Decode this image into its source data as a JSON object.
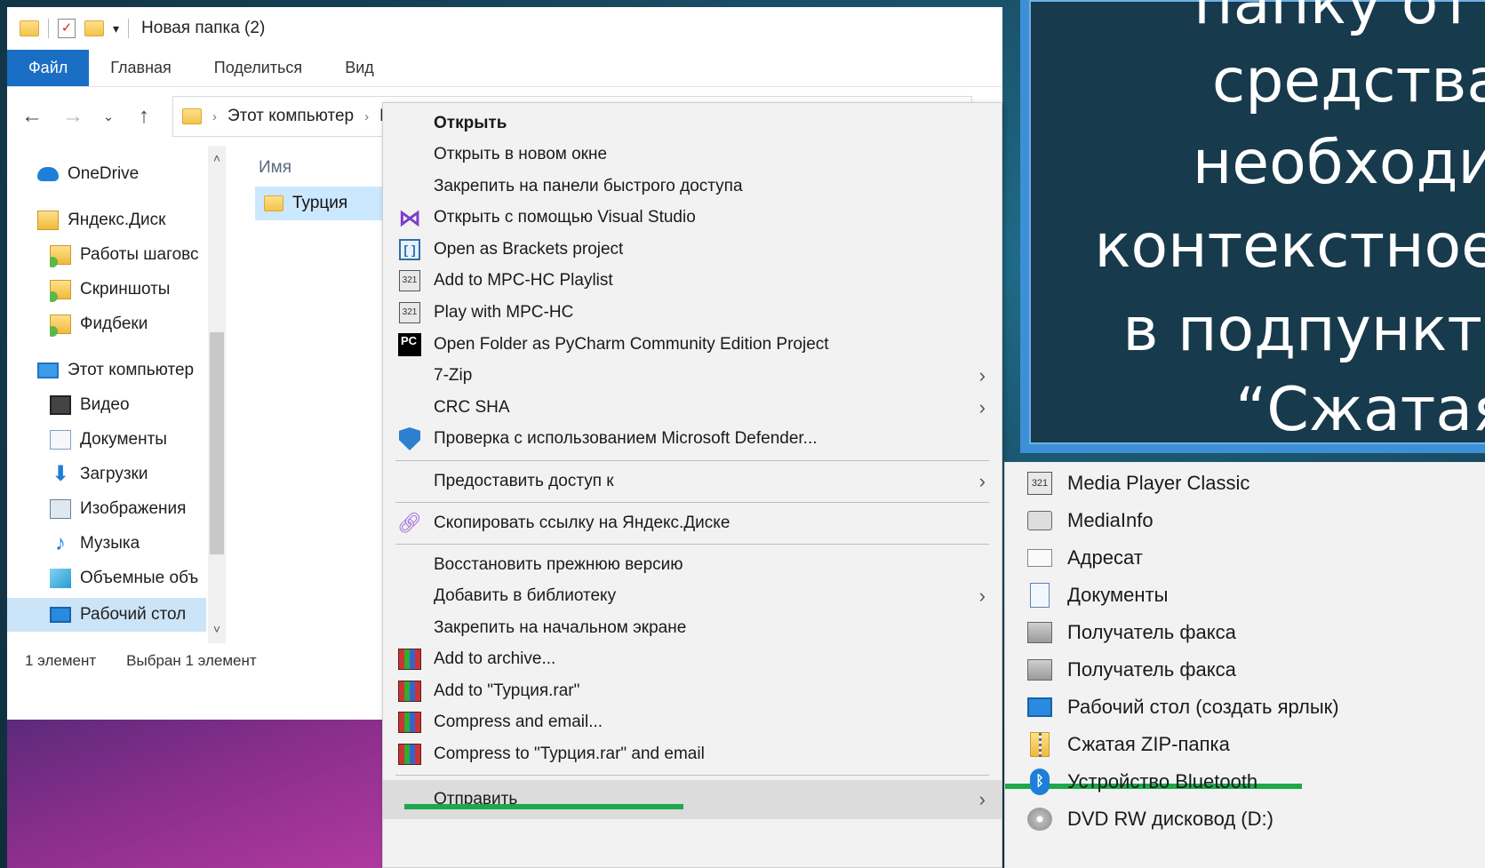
{
  "window": {
    "title": "Новая папка (2)"
  },
  "ribbon": {
    "tabs": [
      "Файл",
      "Главная",
      "Поделиться",
      "Вид"
    ]
  },
  "address": {
    "crumbs": [
      "Этот компьютер",
      "Р"
    ]
  },
  "nav": {
    "items": [
      {
        "label": "OneDrive",
        "icon": "cloud-icon"
      },
      {
        "label": "Яндекс.Диск",
        "icon": "yandex-disk-icon"
      },
      {
        "label": "Работы шаговс",
        "icon": "folder-synced-icon"
      },
      {
        "label": "Скриншоты",
        "icon": "folder-synced-icon"
      },
      {
        "label": "Фидбеки",
        "icon": "folder-synced-icon"
      },
      {
        "label": "Этот компьютер",
        "icon": "computer-icon"
      },
      {
        "label": "Видео",
        "icon": "video-icon"
      },
      {
        "label": "Документы",
        "icon": "documents-icon"
      },
      {
        "label": "Загрузки",
        "icon": "downloads-icon"
      },
      {
        "label": "Изображения",
        "icon": "pictures-icon"
      },
      {
        "label": "Музыка",
        "icon": "music-icon"
      },
      {
        "label": "Объемные объ",
        "icon": "3d-objects-icon"
      },
      {
        "label": "Рабочий стол",
        "icon": "desktop-icon"
      }
    ]
  },
  "files": {
    "column_name": "Имя",
    "items": [
      {
        "label": "Турция",
        "icon": "folder-icon"
      }
    ]
  },
  "status": {
    "count": "1 элемент",
    "selected": "Выбран 1 элемент"
  },
  "context_menu": {
    "items": [
      {
        "label": "Открыть"
      },
      {
        "label": "Открыть в новом окне"
      },
      {
        "label": "Закрепить на панели быстрого доступа"
      },
      {
        "label": "Открыть с помощью Visual Studio",
        "icon": "visual-studio-icon"
      },
      {
        "label": "Open as Brackets project",
        "icon": "brackets-icon"
      },
      {
        "label": "Add to MPC-HC Playlist",
        "icon": "mpc-hc-icon"
      },
      {
        "label": "Play with MPC-HC",
        "icon": "mpc-hc-icon"
      },
      {
        "label": "Open Folder as PyCharm Community Edition Project",
        "icon": "pycharm-icon"
      },
      {
        "label": "7-Zip"
      },
      {
        "label": "CRC SHA"
      },
      {
        "label": "Проверка с использованием Microsoft Defender...",
        "icon": "defender-icon"
      },
      {
        "label": "Предоставить доступ к"
      },
      {
        "label": "Скопировать ссылку на Яндекс.Диске",
        "icon": "link-icon"
      },
      {
        "label": "Восстановить прежнюю версию"
      },
      {
        "label": "Добавить в библиотеку"
      },
      {
        "label": "Закрепить на начальном экране"
      },
      {
        "label": "Add to archive...",
        "icon": "winrar-icon"
      },
      {
        "label": "Add to \"Турция.rar\"",
        "icon": "winrar-icon"
      },
      {
        "label": "Compress and email...",
        "icon": "winrar-icon"
      },
      {
        "label": "Compress to \"Турция.rar\" and email",
        "icon": "winrar-icon"
      },
      {
        "label": "Отправить"
      }
    ]
  },
  "send_to": {
    "items": [
      {
        "label": "Media Player Classic",
        "icon": "mpc-icon"
      },
      {
        "label": "MediaInfo",
        "icon": "mediainfo-icon"
      },
      {
        "label": "Адресат",
        "icon": "mail-recipient-icon"
      },
      {
        "label": "Документы",
        "icon": "documents-icon"
      },
      {
        "label": "Получатель факса",
        "icon": "fax-icon"
      },
      {
        "label": "Получатель факса",
        "icon": "fax-icon"
      },
      {
        "label": "Рабочий стол (создать ярлык)",
        "icon": "desktop-icon"
      },
      {
        "label": "Сжатая ZIP-папка",
        "icon": "zip-folder-icon"
      },
      {
        "label": "Устройство Bluetooth",
        "icon": "bluetooth-icon"
      },
      {
        "label": "DVD RW дисковод (D:)",
        "icon": "dvd-drive-icon"
      }
    ]
  },
  "slide": {
    "lines": [
      "папку от",
      "средства",
      "необходим",
      "контекстное",
      "в подпункт",
      "“Сжатая"
    ]
  },
  "colors": {
    "accent": "#1a6fc4",
    "highlight_underline": "#1ea84b",
    "slide_border": "#3d8fd6"
  }
}
